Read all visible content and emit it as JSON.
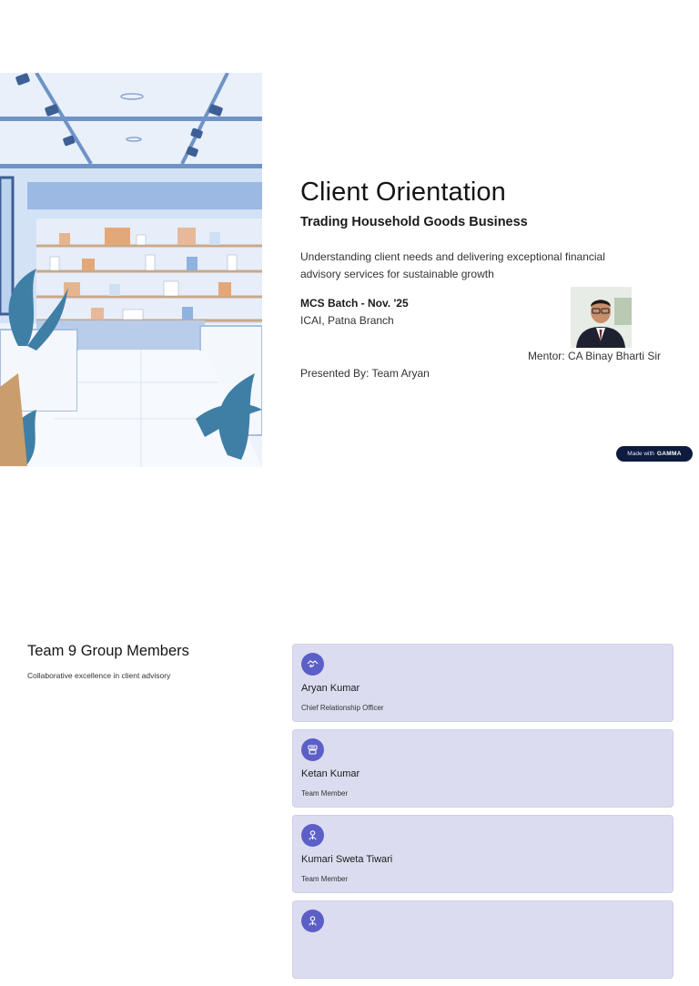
{
  "slide1": {
    "title": "Client Orientation",
    "subtitle": "Trading Household Goods Business",
    "description": "Understanding client needs and delivering exceptional financial advisory services for sustainable growth",
    "batch": "MCS Batch - Nov. '25",
    "branch": "ICAI, Patna Branch",
    "mentor": "Mentor: CA Binay Bharti Sir",
    "presented_by": "Presented By: Team Aryan",
    "badge": {
      "prefix": "Made with",
      "brand": "GAMMA"
    }
  },
  "slide2": {
    "title": "Team 9 Group Members",
    "subtitle": "Collaborative excellence in client advisory",
    "members": [
      {
        "name": "Aryan Kumar",
        "role": "Chief Relationship Officer",
        "icon": "handshake-icon"
      },
      {
        "name": "Ketan Kumar",
        "role": "Team Member",
        "icon": "scroll-icon"
      },
      {
        "name": "Kumari Sweta Tiwari",
        "role": "Team Member",
        "icon": "person-icon"
      },
      {
        "name": "",
        "role": "",
        "icon": "person-icon"
      }
    ]
  },
  "colors": {
    "card_bg": "#dcdcf0",
    "icon_bg": "#5b5fc7",
    "badge_bg": "#0d1b3e"
  }
}
